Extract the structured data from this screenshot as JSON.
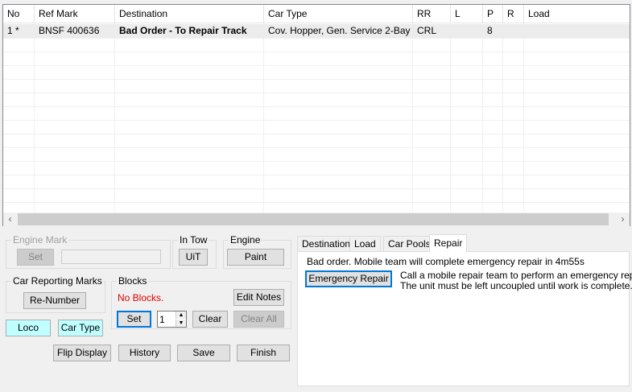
{
  "grid": {
    "columns": [
      "No",
      "Ref Mark",
      "Destination",
      "Car Type",
      "RR",
      "L",
      "P",
      "R",
      "Load"
    ],
    "rows": [
      {
        "no": "1 *",
        "ref_mark": "BNSF 400636",
        "destination": "Bad Order - To Repair Track",
        "car_type": "Cov. Hopper, Gen. Service 2-Bay",
        "rr": "CRL",
        "l": "",
        "p": "8",
        "r": "",
        "load": ""
      }
    ],
    "scroll_left": "‹",
    "scroll_right": "›"
  },
  "engine_mark": {
    "title": "Engine Mark",
    "set_label": "Set",
    "value": ""
  },
  "in_tow": {
    "title": "In Tow",
    "uit_label": "UiT"
  },
  "engine": {
    "title": "Engine",
    "paint_label": "Paint"
  },
  "car_reporting_marks": {
    "title": "Car Reporting Marks",
    "renumber_label": "Re-Number"
  },
  "blocks": {
    "title": "Blocks",
    "status": "No Blocks.",
    "status_color": "#e00000",
    "edit_notes_label": "Edit Notes",
    "set_label": "Set",
    "spinner_value": "1",
    "clear_label": "Clear",
    "clear_all_label": "Clear All"
  },
  "toggles": {
    "loco_label": "Loco",
    "car_type_label": "Car Type"
  },
  "footer": {
    "flip_display": "Flip Display",
    "history": "History",
    "save": "Save",
    "finish": "Finish"
  },
  "tabs": {
    "items": [
      "Destination",
      "Load",
      "Car Pools",
      "Repair"
    ],
    "active": "Repair"
  },
  "repair": {
    "status": "Bad order. Mobile team will complete emergency repair in 4m55s",
    "emergency_button": "Emergency Repair",
    "description_line1": "Call a mobile repair team to perform an emergency repair.",
    "description_line2": "The unit must be left uncoupled until work is complete."
  }
}
